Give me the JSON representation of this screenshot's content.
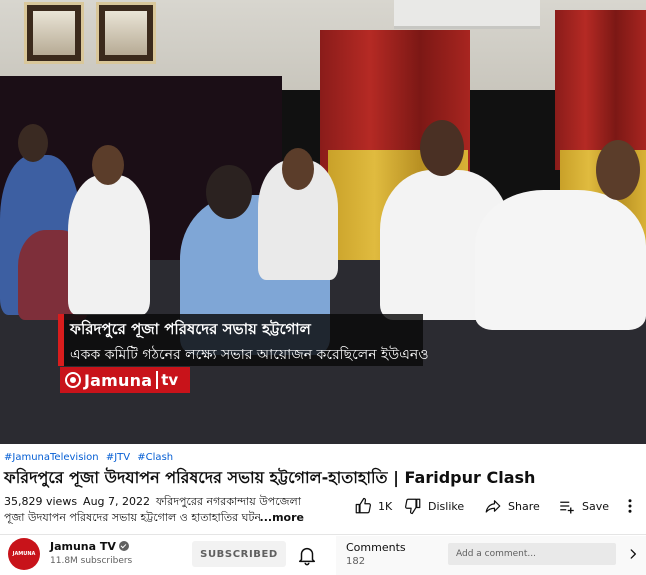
{
  "video": {
    "lower_third": {
      "line1": "ফরিদপুরে পূজা পরিষদের সভায় হট্টগোল",
      "line2": "একক কমিটি গঠনের লক্ষ্যে সভার আয়োজন করেছিলেন ইউএনও"
    },
    "brand": {
      "name": "Jamuna",
      "suffix": "tv"
    }
  },
  "tags": [
    "#JamunaTelevision",
    "#JTV",
    "#Clash"
  ],
  "title": "ফরিদপুরে পূজা উদযাপন পরিষদের সভায় হট্টগোল-হাতাহাতি | Faridpur Clash",
  "description": {
    "views": "35,829 views",
    "date": "Aug 7, 2022",
    "line1": "ফরিদপুরের নগরকান্দায় উপজেলা",
    "line2": "পূজা উদযাপন পরিষদের সভায় হট্টগোল ও হাতাহাতির ঘটনা ঘটেছে",
    "more": "...more"
  },
  "actions": {
    "likes": "1K",
    "dislike": "Dislike",
    "share": "Share",
    "save": "Save"
  },
  "channel": {
    "name": "Jamuna TV",
    "subscribers": "11.8M subscribers",
    "avatar_text": "JAMUNA",
    "subscribe_label": "SUBSCRIBED"
  },
  "comments": {
    "label": "Comments",
    "count": "182",
    "placeholder": "Add a comment..."
  },
  "icons": {
    "like": "thumbs-up-icon",
    "dislike": "thumbs-down-icon",
    "share": "share-arrow-icon",
    "save": "save-plus-icon",
    "more": "more-vertical-icon",
    "bell": "bell-icon",
    "chevron": "chevron-right-icon"
  },
  "colors": {
    "link": "#065fd4",
    "brand_red": "#c8131a",
    "muted": "#606060"
  }
}
